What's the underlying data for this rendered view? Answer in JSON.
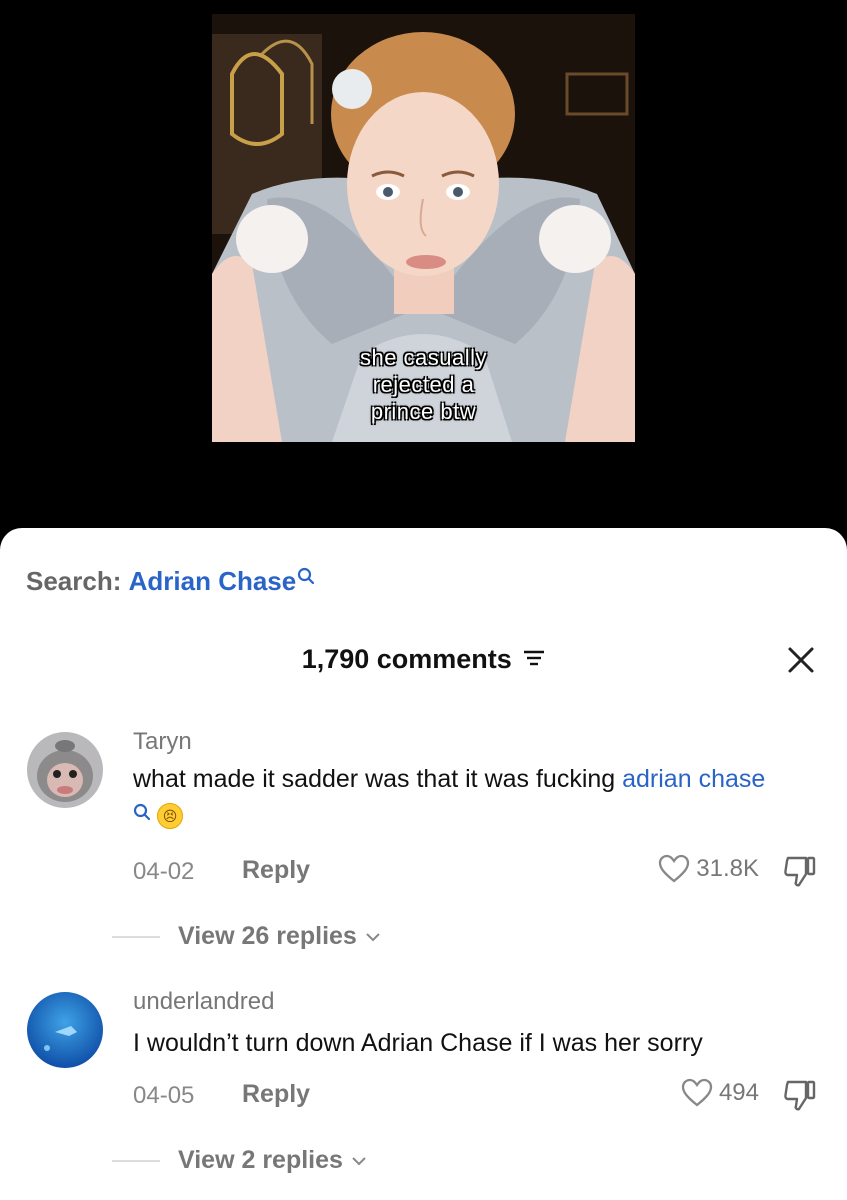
{
  "video": {
    "caption": "she casually\nrejected a\nprince btw"
  },
  "search": {
    "label": "Search:",
    "term": "Adrian Chase"
  },
  "comments_header": {
    "count_label": "1,790 comments"
  },
  "comments": [
    {
      "username": "Taryn",
      "text_before": "what made it sadder was that it was fucking ",
      "mention": "adrian chase",
      "emoji": "😣",
      "date": "04-02",
      "reply_label": "Reply",
      "likes": "31.8K",
      "view_replies": "View 26 replies"
    },
    {
      "username": "underlandred",
      "text": "I wouldn’t turn down Adrian Chase if I was her sorry",
      "date": "04-05",
      "reply_label": "Reply",
      "likes": "494",
      "view_replies": "View 2 replies"
    }
  ],
  "icons": {
    "search": "magnifier-icon",
    "sort": "sort-icon",
    "close": "close-icon",
    "like": "heart-icon",
    "dislike": "thumbs-down-icon",
    "chevron": "chevron-down-icon"
  },
  "colors": {
    "accent": "#2a64c7",
    "sheet": "#ffffff",
    "background": "#000000"
  }
}
